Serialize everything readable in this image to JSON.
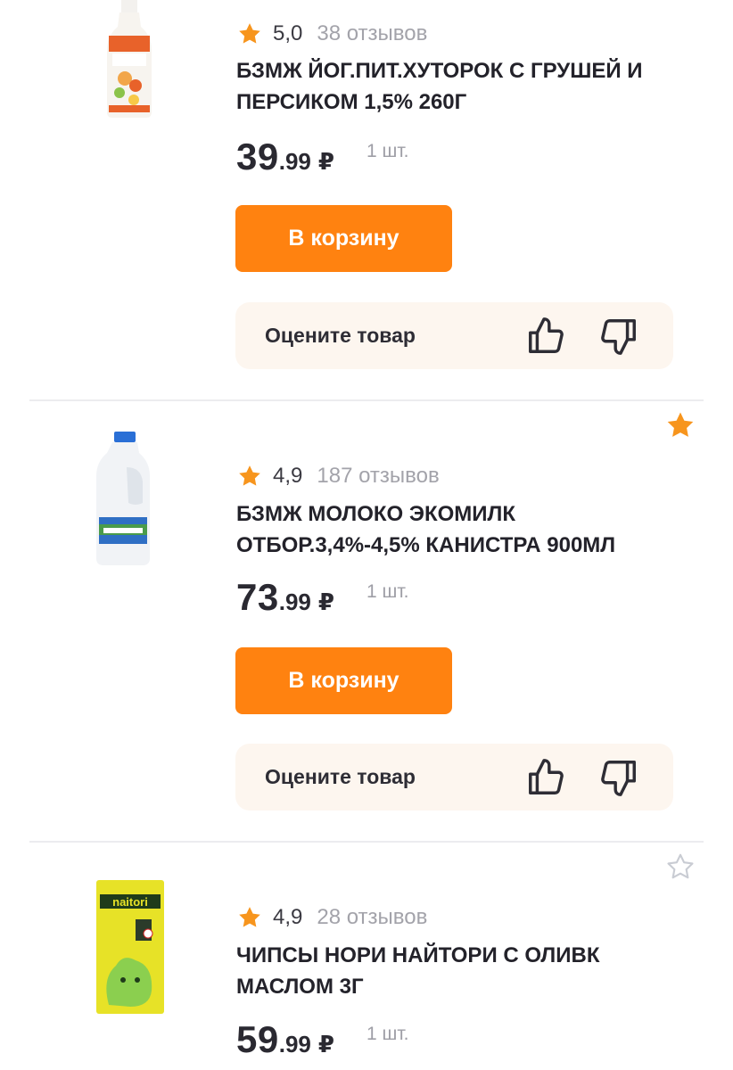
{
  "colors": {
    "accent": "#ff8210",
    "star": "#f7951d",
    "rate_box_bg": "#fdf6ef"
  },
  "products": [
    {
      "rating": "5,0",
      "reviews": "38 отзывов",
      "title": "БЗМЖ ЙОГ.ПИТ.ХУТОРОК С ГРУШЕЙ И ПЕРСИКОМ 1,5% 260Г",
      "price_int": "39",
      "price_frac": ".99",
      "currency": "₽",
      "unit": "1 шт.",
      "cart_label": "В корзину",
      "rate_label": "Оцените товар",
      "favorite": "none",
      "image_label": "ЙОГУРТ 1,5%"
    },
    {
      "rating": "4,9",
      "reviews": "187 отзывов",
      "title": "БЗМЖ МОЛОКО ЭКОМИЛК ОТБОР.3,4%-4,5% КАНИСТРА 900МЛ",
      "price_int": "73",
      "price_frac": ".99",
      "currency": "₽",
      "unit": "1 шт.",
      "cart_label": "В корзину",
      "rate_label": "Оцените товар",
      "favorite": "filled",
      "image_label": "МОЛОКО"
    },
    {
      "rating": "4,9",
      "reviews": "28 отзывов",
      "title": "ЧИПСЫ НОРИ НАЙТОРИ С ОЛИВК МАСЛОМ 3Г",
      "price_int": "59",
      "price_frac": ".99",
      "currency": "₽",
      "unit": "1 шт.",
      "favorite": "outline",
      "image_label": "naitori"
    }
  ]
}
